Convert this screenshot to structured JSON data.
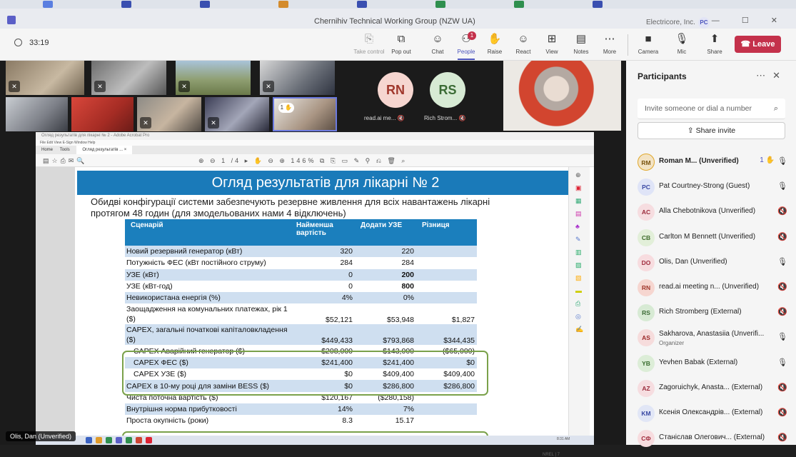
{
  "window": {
    "title": "Chernihiv Technical Working Group (NZW UA)",
    "org": "Electricore, Inc.",
    "org_badge": "PC",
    "controls": "— ☐ ✕"
  },
  "toolbar": {
    "timer": "33:19",
    "buttons": [
      {
        "label": "Take control",
        "icon": "⎘"
      },
      {
        "label": "Pop out",
        "icon": "⧉"
      },
      {
        "label": "Chat",
        "icon": "☺"
      },
      {
        "label": "People",
        "icon": "⚇",
        "badge": "1"
      },
      {
        "label": "Raise",
        "icon": "✋"
      },
      {
        "label": "React",
        "icon": "☺"
      },
      {
        "label": "View",
        "icon": "⊞"
      },
      {
        "label": "Notes",
        "icon": "▤"
      },
      {
        "label": "More",
        "icon": "⋯"
      },
      {
        "label": "Camera",
        "icon": "■"
      },
      {
        "label": "Mic",
        "icon": "🎙"
      },
      {
        "label": "Share",
        "icon": "⬆"
      }
    ],
    "leave_label": "Leave"
  },
  "stage": {
    "avatars": [
      {
        "initials": "RN",
        "label": "read.ai me...",
        "bg": "#f6d6d0",
        "fg": "#a0372c"
      },
      {
        "initials": "RS",
        "label": "Rich Strom...",
        "bg": "#d7ead4",
        "fg": "#3b6b35"
      }
    ],
    "hand_count": "1",
    "speaker_tag": "Olis, Dan (Unverified)"
  },
  "pdf": {
    "window_title": "Огляд результатів для лікарні № 2 - Adobe Acrobat Pro",
    "menu": "File  Edit  View  E-Sign  Window  Help",
    "tabs": [
      "Home",
      "Tools",
      "Огляд результатів ... ×"
    ],
    "page_info": "1 /4",
    "zoom": "146%",
    "footer": "NREL  |  7",
    "clock": "8:31 AM"
  },
  "slide": {
    "title": "Огляд результатів для лікарні № 2",
    "subtitle": "Обидві конфігурації системи забезпечують резервне живлення для всіх навантажень лікарні протягом 48 годин (для змодельованих нами 4 відключень)",
    "headers": [
      "Сценарій",
      "Найменша вартість",
      "Додати УЗЕ",
      "Різниця"
    ],
    "rows": [
      {
        "label": "Новий резервний генератор (кВт)",
        "a": "320",
        "b": "220",
        "c": "",
        "alt": true
      },
      {
        "label": "Потужність ФЕС (кВт постійного струму)",
        "a": "284",
        "b": "284",
        "c": "",
        "alt": false
      },
      {
        "label": "УЗЕ (кВт)",
        "a": "0",
        "b": "200",
        "c": "",
        "alt": true,
        "bold_b": true
      },
      {
        "label": "УЗЕ (кВт-год)",
        "a": "0",
        "b": "800",
        "c": "",
        "alt": false,
        "bold_b": true
      },
      {
        "label": "Невикористана енергія (%)",
        "a": "4%",
        "b": "0%",
        "c": "",
        "alt": true
      },
      {
        "label": "Заощадження на комунальних платежах, рік 1 ($)",
        "a": "$52,121",
        "b": "$53,948",
        "c": "$1,827",
        "alt": false,
        "tall": true
      },
      {
        "label": "CAPEX, загальні початкові капіталовкладення ($)",
        "a": "$449,433",
        "b": "$793,868",
        "c": "$344,435",
        "alt": true,
        "tall": true
      },
      {
        "label": "  CAPEX Аварійний генератор ($)",
        "a": "$208,000",
        "b": "$143,000",
        "c": "($65,000)",
        "alt": false
      },
      {
        "label": "  CAPEX ФЕС ($)",
        "a": "$241,400",
        "b": "$241,400",
        "c": "$0",
        "alt": true
      },
      {
        "label": "  CAPEX УЗЕ ($)",
        "a": "$0",
        "b": "$409,400",
        "c": "$409,400",
        "alt": false
      },
      {
        "label": "CAPEX в 10-му році для заміни BESS ($)",
        "a": "$0",
        "b": "$286,800",
        "c": "$286,800",
        "alt": true
      },
      {
        "label": "Чиста поточна вартість ($)",
        "a": "$120,167",
        "b": "($280,158)",
        "c": "",
        "alt": false
      },
      {
        "label": "Внутрішня норма прибутковості",
        "a": "14%",
        "b": "7%",
        "c": "",
        "alt": true
      },
      {
        "label": "Проста окупність (роки)",
        "a": "8.3",
        "b": "15.17",
        "c": "",
        "alt": false
      }
    ]
  },
  "panel": {
    "title": "Participants",
    "invite_placeholder": "Invite someone or dial a number",
    "share_invite": "Share invite",
    "participants": [
      {
        "initials": "RM",
        "name": "Roman M... (Unverified)",
        "bold": true,
        "hand": "1",
        "mic": "on",
        "bg": "#f3e3c4",
        "fg": "#7a5410"
      },
      {
        "initials": "PC",
        "name": "Pat Courtney-Strong (Guest)",
        "mic": "on",
        "bg": "#dfe4f7",
        "fg": "#3a49a4"
      },
      {
        "initials": "AC",
        "name": "Alla Chebotnikova (Unverified)",
        "mic": "off",
        "bg": "#f6dde0",
        "fg": "#9b2c3c"
      },
      {
        "initials": "CB",
        "name": "Carlton M Bennett (Unverified)",
        "mic": "off",
        "bg": "#e2efd9",
        "fg": "#3d6b2a"
      },
      {
        "initials": "DO",
        "name": "Olis, Dan (Unverified)",
        "mic": "on",
        "bg": "#f7dcdf",
        "fg": "#a12c3e"
      },
      {
        "initials": "RN",
        "name": "read.ai meeting n... (Unverified)",
        "mic": "off",
        "bg": "#f6d6d0",
        "fg": "#a0372c"
      },
      {
        "initials": "RS",
        "name": "Rich Stromberg (External)",
        "mic": "off",
        "bg": "#d7ead4",
        "fg": "#3b6b35"
      },
      {
        "initials": "AS",
        "name": "Sakharova, Anastasiia (Unverifi...",
        "sub": "Organizer",
        "mic": "on",
        "bg": "#f6dcdc",
        "fg": "#9c2a2a"
      },
      {
        "initials": "YB",
        "name": "Yevhen Babak (External)",
        "mic": "on",
        "bg": "#dcedd7",
        "fg": "#386b2d"
      },
      {
        "initials": "AZ",
        "name": "Zagoruichyk, Anasta... (External)",
        "mic": "off",
        "bg": "#f6dde0",
        "fg": "#9b2c3c"
      },
      {
        "initials": "KM",
        "name": "Ксенія Олександрів... (External)",
        "mic": "off",
        "bg": "#e1e6f6",
        "fg": "#3a49a4"
      },
      {
        "initials": "СФ",
        "name": "Станіслав Олегович... (External)",
        "mic": "off",
        "bg": "#f7dcdf",
        "fg": "#a12c3e"
      }
    ]
  }
}
